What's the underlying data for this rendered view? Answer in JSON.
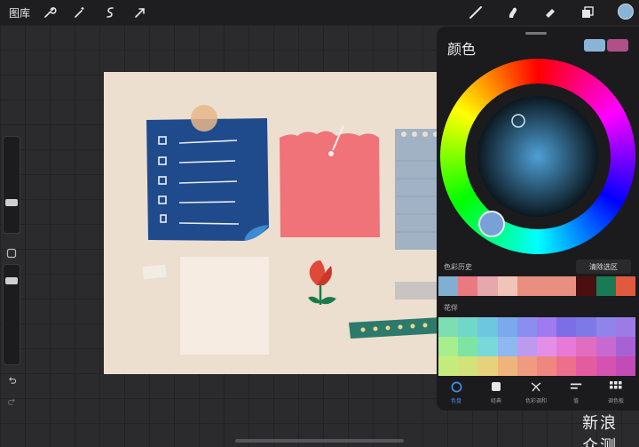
{
  "topbar": {
    "gallery_label": "图库",
    "tools_left": [
      "wrench-icon",
      "magic-wand-icon",
      "selection-icon",
      "move-arrow-icon"
    ],
    "tools_right": [
      "brush-icon",
      "smudge-icon",
      "eraser-icon",
      "layers-icon"
    ],
    "current_color": "#8ab4d6"
  },
  "panel": {
    "title": "颜色",
    "primary_swatch": "#8ab4d6",
    "secondary_swatch": "#b04f88",
    "history_label": "色彩历史",
    "clear_label": "清除选区",
    "history_colors": [
      "#7fb0d2",
      "#e87a80",
      "#e6a7ad",
      "#f1c4b8",
      "#e88f7f",
      "#e88f7f",
      "#e88f7f",
      "#4a0f10",
      "#177b56",
      "#e05a3f"
    ],
    "palette_label": "花伴",
    "palette_colors": [
      "#7ddfb1",
      "#71d7c8",
      "#6cc7df",
      "#7aa9ec",
      "#8b8df0",
      "#9f7af0",
      "#7c6ee6",
      "#7d7ae8",
      "#8e84ec",
      "#9b7be6",
      "#a6ef8c",
      "#7fe3a4",
      "#79d9d8",
      "#8fb8ef",
      "#bd9af0",
      "#e38fe7",
      "#e77ad8",
      "#e06dc0",
      "#c869d0",
      "#a861d5",
      "#c4ec7c",
      "#d2e37a",
      "#e6d27c",
      "#efb47c",
      "#f09a80",
      "#f0877e",
      "#ec6f8c",
      "#e35d9e",
      "#d552b0",
      "#c14cb6"
    ],
    "tabs": [
      {
        "label": "色盘",
        "icon": "disc-icon"
      },
      {
        "label": "经典",
        "icon": "square-icon"
      },
      {
        "label": "色彩调和",
        "icon": "harmony-icon"
      },
      {
        "label": "值",
        "icon": "sliders-icon"
      },
      {
        "label": "调色板",
        "icon": "grid-icon"
      }
    ]
  },
  "watermark": "新浪 众测"
}
